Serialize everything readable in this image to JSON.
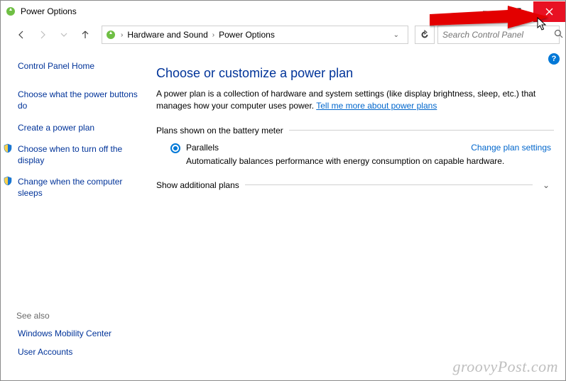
{
  "title": "Power Options",
  "breadcrumb": {
    "item1": "Hardware and Sound",
    "item2": "Power Options"
  },
  "search": {
    "placeholder": "Search Control Panel"
  },
  "sidebar": {
    "home": "Control Panel Home",
    "link1": "Choose what the power buttons do",
    "link2": "Create a power plan",
    "link3": "Choose when to turn off the display",
    "link4": "Change when the computer sleeps",
    "see_also_label": "See also",
    "see1": "Windows Mobility Center",
    "see2": "User Accounts"
  },
  "main": {
    "heading": "Choose or customize a power plan",
    "desc_pre": "A power plan is a collection of hardware and system settings (like display brightness, sleep, etc.) that manages how your computer uses power. ",
    "desc_link": "Tell me more about power plans",
    "section1_label": "Plans shown on the battery meter",
    "plan_name": "Parallels",
    "change_link": "Change plan settings",
    "plan_desc": "Automatically balances performance with energy consumption on capable hardware.",
    "section2_label": "Show additional plans"
  },
  "watermark": "groovyPost.com"
}
